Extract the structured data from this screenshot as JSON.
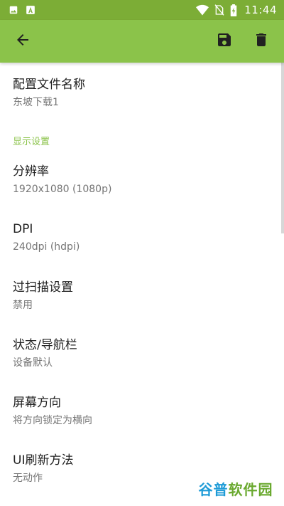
{
  "status_bar": {
    "time": "11:44",
    "left_icons": [
      "image-notification-icon",
      "a-notification-icon"
    ],
    "right_icons": [
      "wifi-icon",
      "no-sim-icon",
      "battery-icon"
    ]
  },
  "app_bar": {
    "back_icon": "arrow-back-icon",
    "actions": [
      {
        "icon": "save-icon"
      },
      {
        "icon": "delete-icon"
      }
    ]
  },
  "prefs": {
    "profile_name": {
      "title": "配置文件名称",
      "summary": "东坡下载1"
    },
    "display_category": "显示设置",
    "resolution": {
      "title": "分辨率",
      "summary": "1920x1080 (1080p)"
    },
    "dpi": {
      "title": "DPI",
      "summary": "240dpi (hdpi)"
    },
    "overscan": {
      "title": "过扫描设置",
      "summary": "禁用"
    },
    "status_nav": {
      "title": "状态/导航栏",
      "summary": "设备默认"
    },
    "orientation": {
      "title": "屏幕方向",
      "summary": "将方向锁定为横向"
    },
    "ui_refresh": {
      "title": "UI刷新方法",
      "summary": "无动作"
    }
  },
  "watermark": {
    "part1": "谷普",
    "part2": "软件园"
  },
  "colors": {
    "status_bar": "#7cad36",
    "app_bar": "#8bc34a",
    "category_text": "#8bc34a",
    "title_text": "#212121",
    "summary_text": "#757575"
  }
}
